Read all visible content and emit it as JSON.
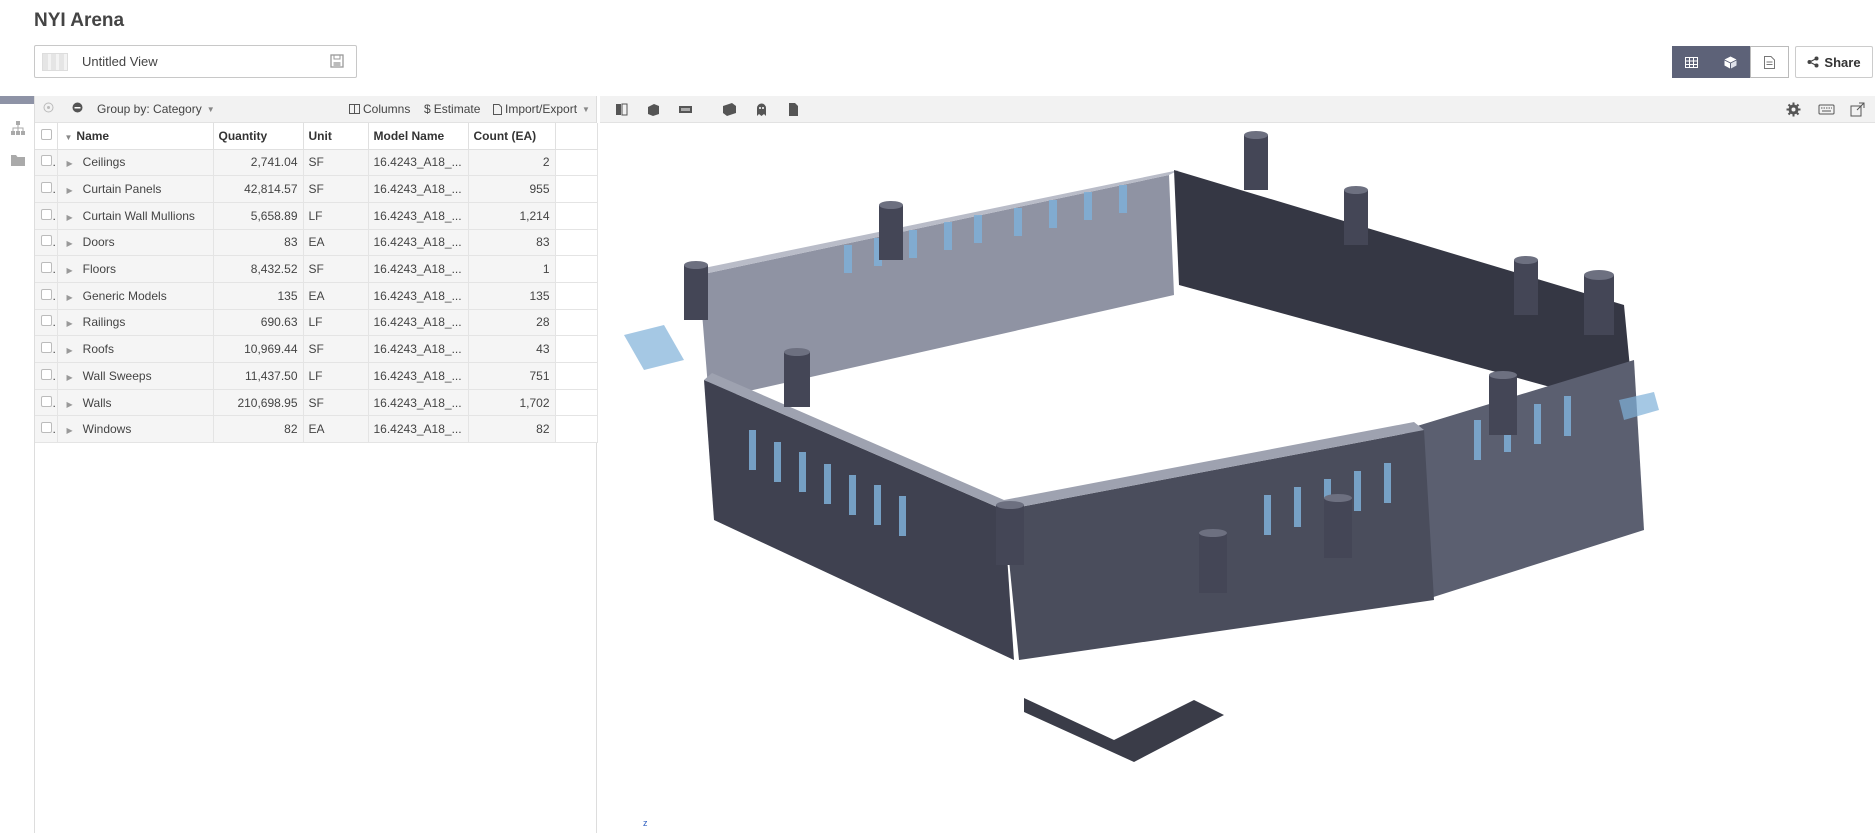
{
  "app": {
    "title": "NYI Arena"
  },
  "view": {
    "name": "Untitled View",
    "icons": {
      "thumb": "view-thumbnail",
      "save": "floppy-disk-icon"
    }
  },
  "header": {
    "toggles": [
      {
        "name": "grid-view",
        "icon": "table-icon",
        "active": true
      },
      {
        "name": "model-view",
        "icon": "cube-icon",
        "active": true
      },
      {
        "name": "document-view",
        "icon": "document-icon",
        "active": false
      }
    ],
    "share_label": "Share"
  },
  "toolbar": {
    "group_by": "Group by: Category",
    "columns": "Columns",
    "estimate": "Estimate",
    "import_export": "Import/Export"
  },
  "table": {
    "columns": [
      "Name",
      "Quantity",
      "Unit",
      "Model Name",
      "Count (EA)"
    ],
    "rows": [
      {
        "name": "Ceilings",
        "quantity": "2,741.04",
        "unit": "SF",
        "model": "16.4243_A18_...",
        "count": "2"
      },
      {
        "name": "Curtain Panels",
        "quantity": "42,814.57",
        "unit": "SF",
        "model": "16.4243_A18_...",
        "count": "955"
      },
      {
        "name": "Curtain Wall Mullions",
        "quantity": "5,658.89",
        "unit": "LF",
        "model": "16.4243_A18_...",
        "count": "1,214"
      },
      {
        "name": "Doors",
        "quantity": "83",
        "unit": "EA",
        "model": "16.4243_A18_...",
        "count": "83"
      },
      {
        "name": "Floors",
        "quantity": "8,432.52",
        "unit": "SF",
        "model": "16.4243_A18_...",
        "count": "1"
      },
      {
        "name": "Generic Models",
        "quantity": "135",
        "unit": "EA",
        "model": "16.4243_A18_...",
        "count": "135"
      },
      {
        "name": "Railings",
        "quantity": "690.63",
        "unit": "LF",
        "model": "16.4243_A18_...",
        "count": "28"
      },
      {
        "name": "Roofs",
        "quantity": "10,969.44",
        "unit": "SF",
        "model": "16.4243_A18_...",
        "count": "43"
      },
      {
        "name": "Wall Sweeps",
        "quantity": "11,437.50",
        "unit": "LF",
        "model": "16.4243_A18_...",
        "count": "751"
      },
      {
        "name": "Walls",
        "quantity": "210,698.95",
        "unit": "SF",
        "model": "16.4243_A18_...",
        "count": "1,702"
      },
      {
        "name": "Windows",
        "quantity": "82",
        "unit": "EA",
        "model": "16.4243_A18_...",
        "count": "82"
      }
    ]
  },
  "viewer": {
    "axis_label": "z"
  },
  "colors": {
    "accent": "#5d6278",
    "wall_dark": "#3f4150",
    "wall_light": "#8f93a3",
    "glass": "#7fb0d8"
  }
}
